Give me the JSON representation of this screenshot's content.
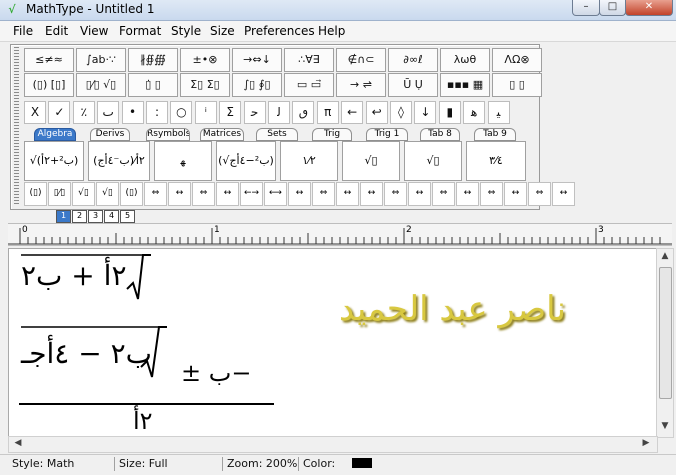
{
  "window": {
    "title": "MathType - Untitled 1",
    "minimize": "–",
    "maximize": "□",
    "close": "✕"
  },
  "menu": [
    "File",
    "Edit",
    "View",
    "Format",
    "Style",
    "Size",
    "Preferences",
    "Help"
  ],
  "palette_row1": [
    "≤≠≈",
    "∫ab·∵",
    "∦∯∰",
    "±•⊗",
    "→⇔↓",
    "∴∀∃",
    "∉∩⊂",
    "∂∞ℓ",
    "λωθ",
    "ΛΩ⊗"
  ],
  "palette_row2": [
    "(▯) [▯]",
    "▯⁄▯ √▯",
    "▯̇ ▯",
    "Σ▯ Σ▯",
    "∫▯ ∮▯",
    "▭ ▭⃗",
    "→ ⇌",
    "Ū Ụ",
    "▪▪▪ ▦",
    "▯ ▯"
  ],
  "symbol_row": [
    "X",
    "✓",
    "٪",
    "ٮ",
    "•",
    ":",
    "○",
    "ⁱ",
    "Σ",
    "ﺣ",
    "ﻟ",
    "ٯ",
    "π",
    "←",
    "↩",
    "◊",
    "↓",
    "▮",
    "ﻫ",
    "ﯿ"
  ],
  "tabs": [
    "Algebra",
    "Derivs",
    "Rsymbols",
    "Matrices",
    "Sets",
    "Trig",
    "Trig 1",
    "Tab 8",
    "Tab 9"
  ],
  "templates": [
    "√(ب²+٢أ)",
    "(ب⁻٤أج)⁄٢أ",
    "ﻬ",
    "(√ب²−٤أج)",
    "١⁄٢",
    "√▯",
    "√▯",
    "٣⁄٤"
  ],
  "small_templates": [
    "(▯)",
    "▯⁄▯",
    "√▯",
    "√▯",
    "(▯)",
    "⇔",
    "↔",
    "⇔",
    "↔",
    "←→",
    "⟷",
    "↔",
    "⇔",
    "↔",
    "↔",
    "⇔",
    "↔",
    "⇔",
    "↔",
    "⇔",
    "↔",
    "⇔",
    "↔"
  ],
  "size_tabs": [
    "1",
    "2",
    "3",
    "4",
    "5"
  ],
  "ruler": {
    "labels": [
      "0",
      "1",
      "2",
      "3"
    ]
  },
  "equation": {
    "top_radicand": "٢أ + ب٢",
    "sqrt_inner": "ب٢ − ٤أجـ",
    "numerator_prefix": "−ب ±",
    "denominator": "٢أ"
  },
  "watermark": "ناصر عبد الحميد",
  "status": {
    "style": "Style: Math",
    "size": "Size: Full",
    "zoom": "Zoom: 200%",
    "color_label": "Color:",
    "color_value": "#000000"
  },
  "colors": {
    "accent": "#3b79c9",
    "watermark": "#d8c840"
  }
}
